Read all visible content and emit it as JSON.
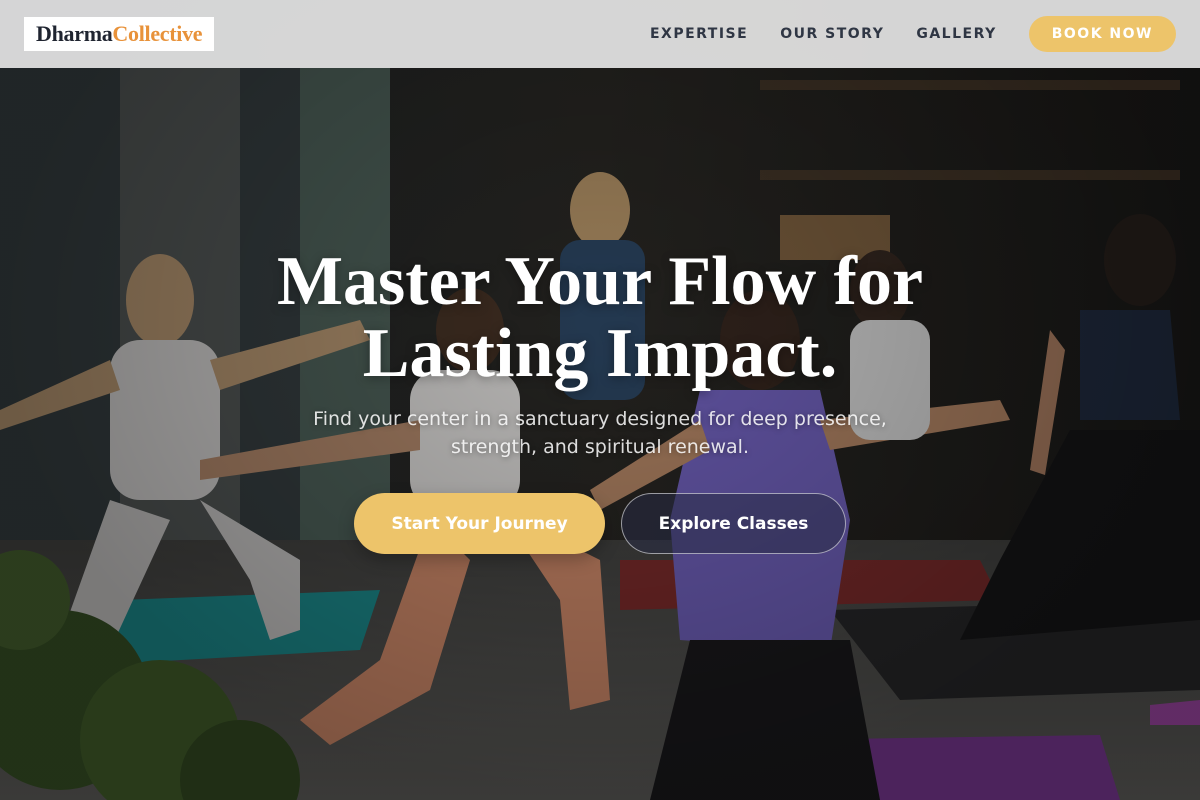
{
  "brand": {
    "name_part1": "Dharma",
    "name_part2": "Collective"
  },
  "nav": {
    "links": [
      "EXPERTISE",
      "OUR STORY",
      "GALLERY"
    ],
    "book_label": "BOOK NOW"
  },
  "hero": {
    "title_line1": "Master Your Flow for",
    "title_line2": "Lasting Impact.",
    "subtitle_line1": "Find your center in a sanctuary designed for deep presence,",
    "subtitle_line2": "strength, and spiritual renewal.",
    "primary_cta": "Start Your Journey",
    "secondary_cta": "Explore Classes",
    "background_image": "group yoga class in studio"
  },
  "colors": {
    "accent": "#edc46a",
    "logo_accent": "#e8923a",
    "nav_text": "#2f3644",
    "header_bg": "#dedede"
  }
}
